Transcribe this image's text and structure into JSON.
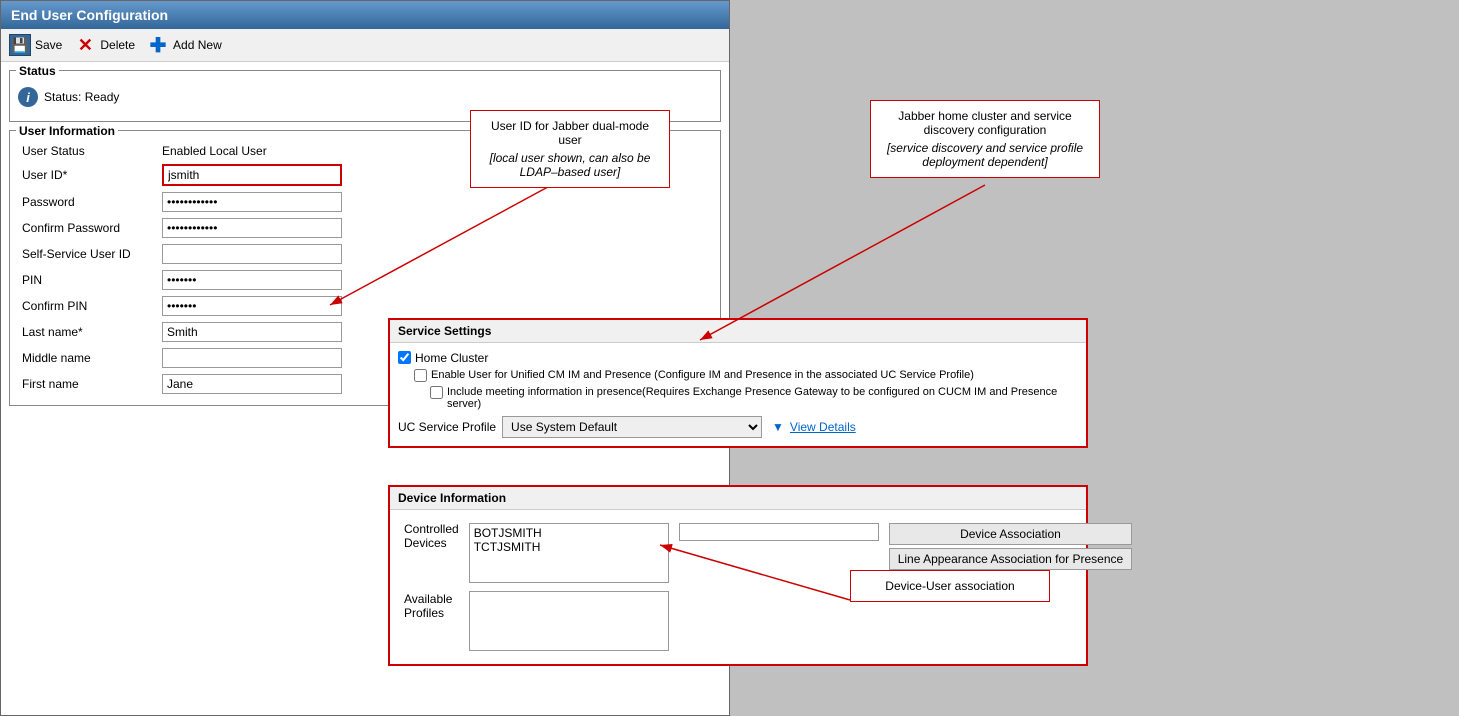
{
  "window": {
    "title": "End User Configuration"
  },
  "toolbar": {
    "save_label": "Save",
    "delete_label": "Delete",
    "add_new_label": "Add New"
  },
  "status_section": {
    "title": "Status",
    "status_label": "Status: Ready"
  },
  "user_info_section": {
    "title": "User Information",
    "fields": [
      {
        "label": "User Status",
        "value": "Enabled Local User",
        "type": "text",
        "input": false
      },
      {
        "label": "User ID*",
        "value": "jsmith",
        "type": "input",
        "highlighted": true
      },
      {
        "label": "Password",
        "value": "••••••••••••••",
        "type": "password"
      },
      {
        "label": "Confirm Password",
        "value": "••••••••••••••",
        "type": "password"
      },
      {
        "label": "Self-Service User ID",
        "value": "",
        "type": "input"
      },
      {
        "label": "PIN",
        "value": "••••••••••••••",
        "type": "password"
      },
      {
        "label": "Confirm PIN",
        "value": "••••••••••••••",
        "type": "password"
      },
      {
        "label": "Last name*",
        "value": "Smith",
        "type": "input"
      },
      {
        "label": "Middle name",
        "value": "",
        "type": "input"
      },
      {
        "label": "First name",
        "value": "Jane",
        "type": "input"
      }
    ]
  },
  "service_settings": {
    "title": "Service Settings",
    "home_cluster_label": "Home Cluster",
    "home_cluster_checked": true,
    "enable_user_label": "Enable User for Unified CM IM and Presence (Configure IM and Presence in the associated UC Service Profile)",
    "enable_user_checked": false,
    "include_meeting_label": "Include meeting information in presence(Requires Exchange Presence Gateway to be configured on CUCM IM and Presence server)",
    "include_meeting_checked": false,
    "uc_service_profile_label": "UC Service Profile",
    "uc_service_profile_value": "Use System Default",
    "view_details_label": "View Details"
  },
  "device_info": {
    "title": "Device Information",
    "controlled_devices_label": "Controlled Devices",
    "controlled_devices": [
      "BOTJSMITH",
      "TCTJSMITH"
    ],
    "device_association_btn": "Device Association",
    "line_appearance_btn": "Line Appearance Association for Presence",
    "available_profiles_label": "Available Profiles"
  },
  "callouts": {
    "callout1_title": "User ID for Jabber dual-mode user",
    "callout1_sub": "[local user shown, can also be LDAP–based user]",
    "callout2_title": "Jabber home cluster and service discovery configuration",
    "callout2_sub": "[service discovery and  service profile deployment dependent]",
    "callout3_title": "Device-User association"
  }
}
